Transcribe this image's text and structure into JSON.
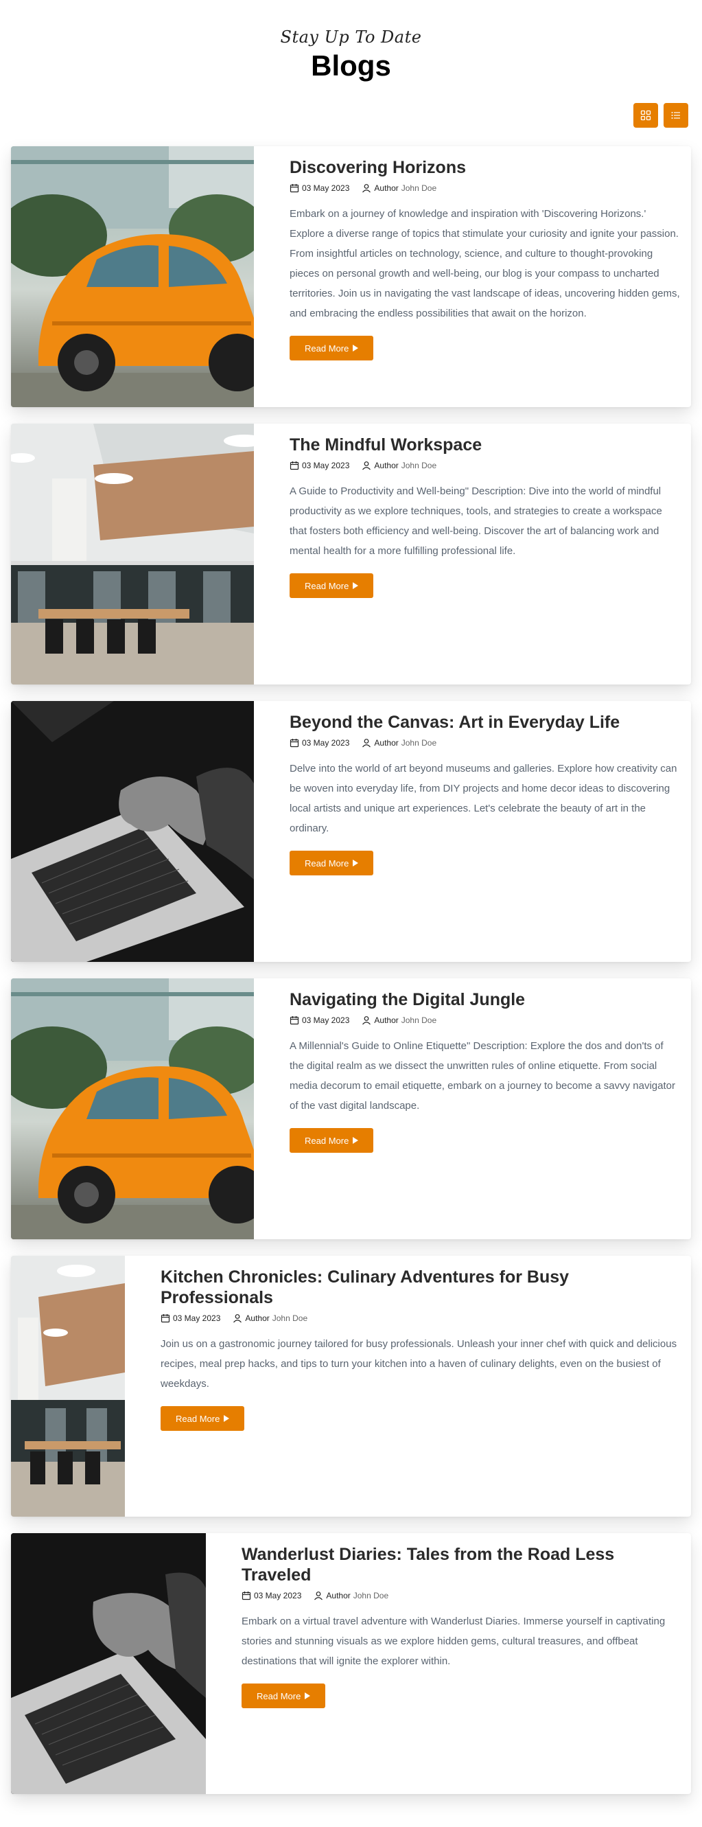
{
  "header": {
    "tagline": "Stay Up To Date",
    "title": "Blogs"
  },
  "view_toggles": [
    {
      "icon": "grid-icon"
    },
    {
      "icon": "list-icon"
    }
  ],
  "meta_labels": {
    "author_label": "Author",
    "read_more": "Read More"
  },
  "colors": {
    "accent": "#e67e00",
    "text": "#2a2a2a",
    "muted": "#5a6470"
  },
  "posts": [
    {
      "image": "orange-beetle-car",
      "title": "Discovering Horizons",
      "date": "03 May 2023",
      "author": "John Doe",
      "excerpt": "Embark on a journey of knowledge and inspiration with 'Discovering Horizons.' Explore a diverse range of topics that stimulate your curiosity and ignite your passion. From insightful articles on technology, science, and culture to thought-provoking pieces on personal growth and well-being, our blog is your compass to uncharted territories. Join us in navigating the vast landscape of ideas, uncovering hidden gems, and embracing the endless possibilities that await on the horizon."
    },
    {
      "image": "office-workspace",
      "title": "The Mindful Workspace",
      "date": "03 May 2023",
      "author": "John Doe",
      "excerpt": "A Guide to Productivity and Well-being\" Description: Dive into the world of mindful productivity as we explore techniques, tools, and strategies to create a workspace that fosters both efficiency and well-being. Discover the art of balancing work and mental health for a more fulfilling professional life."
    },
    {
      "image": "hands-on-laptop",
      "title": "Beyond the Canvas: Art in Everyday Life",
      "date": "03 May 2023",
      "author": "John Doe",
      "excerpt": "Delve into the world of art beyond museums and galleries. Explore how creativity can be woven into everyday life, from DIY projects and home decor ideas to discovering local artists and unique art experiences. Let's celebrate the beauty of art in the ordinary."
    },
    {
      "image": "orange-beetle-car",
      "title": "Navigating the Digital Jungle",
      "date": "03 May 2023",
      "author": "John Doe",
      "excerpt": "A Millennial's Guide to Online Etiquette\" Description: Explore the dos and don'ts of the digital realm as we dissect the unwritten rules of online etiquette. From social media decorum to email etiquette, embark on a journey to become a savvy navigator of the vast digital landscape."
    },
    {
      "image": "office-workspace",
      "title": "Kitchen Chronicles: Culinary Adventures for Busy Professionals",
      "date": "03 May 2023",
      "author": "John Doe",
      "excerpt": "Join us on a gastronomic journey tailored for busy professionals. Unleash your inner chef with quick and delicious recipes, meal prep hacks, and tips to turn your kitchen into a haven of culinary delights, even on the busiest of weekdays."
    },
    {
      "image": "hands-on-laptop",
      "title": "Wanderlust Diaries: Tales from the Road Less Traveled",
      "date": "03 May 2023",
      "author": "John Doe",
      "excerpt": "Embark on a virtual travel adventure with Wanderlust Diaries. Immerse yourself in captivating stories and stunning visuals as we explore hidden gems, cultural treasures, and offbeat destinations that will ignite the explorer within."
    }
  ]
}
